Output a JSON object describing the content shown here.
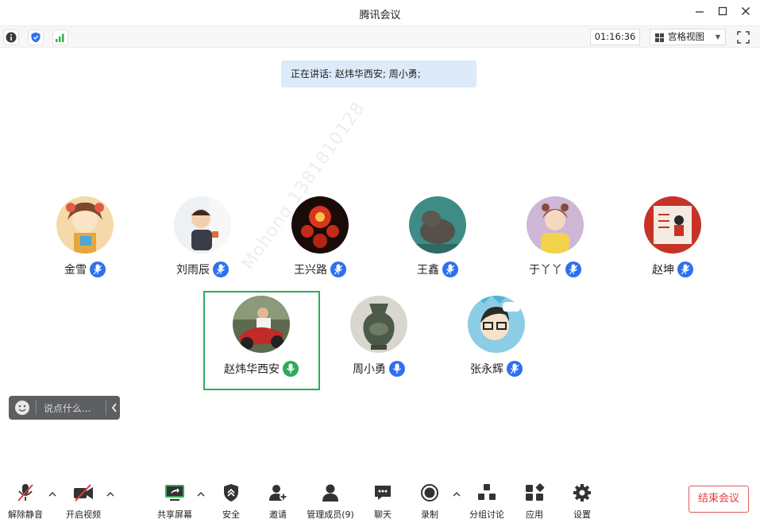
{
  "window": {
    "title": "腾讯会议"
  },
  "statusbar": {
    "timer": "01:16:36",
    "view_label": "宫格视图"
  },
  "speaking": {
    "text": "正在讲话: 赵炜华西安; 周小勇;"
  },
  "participants": [
    {
      "name": "金雪"
    },
    {
      "name": "刘雨辰"
    },
    {
      "name": "王兴路"
    },
    {
      "name": "王鑫"
    },
    {
      "name": "于丫丫"
    },
    {
      "name": "赵坤"
    },
    {
      "name": "赵炜华西安"
    },
    {
      "name": "周小勇"
    },
    {
      "name": "张永辉"
    }
  ],
  "chat": {
    "placeholder": "说点什么..."
  },
  "toolbar": {
    "unmute": "解除静音",
    "video": "开启视频",
    "share": "共享屏幕",
    "security": "安全",
    "invite": "邀请",
    "members": "管理成员(9)",
    "chat": "聊天",
    "record": "录制",
    "breakout": "分组讨论",
    "apps": "应用",
    "settings": "设置",
    "end": "结束会议"
  },
  "colors": {
    "accent": "#2f6ff0",
    "speaking_bg": "#dceaf9",
    "active_border": "#2faa5c",
    "end_red": "#e03c3c"
  },
  "watermark": {
    "text": "Mohong 1381810128"
  }
}
